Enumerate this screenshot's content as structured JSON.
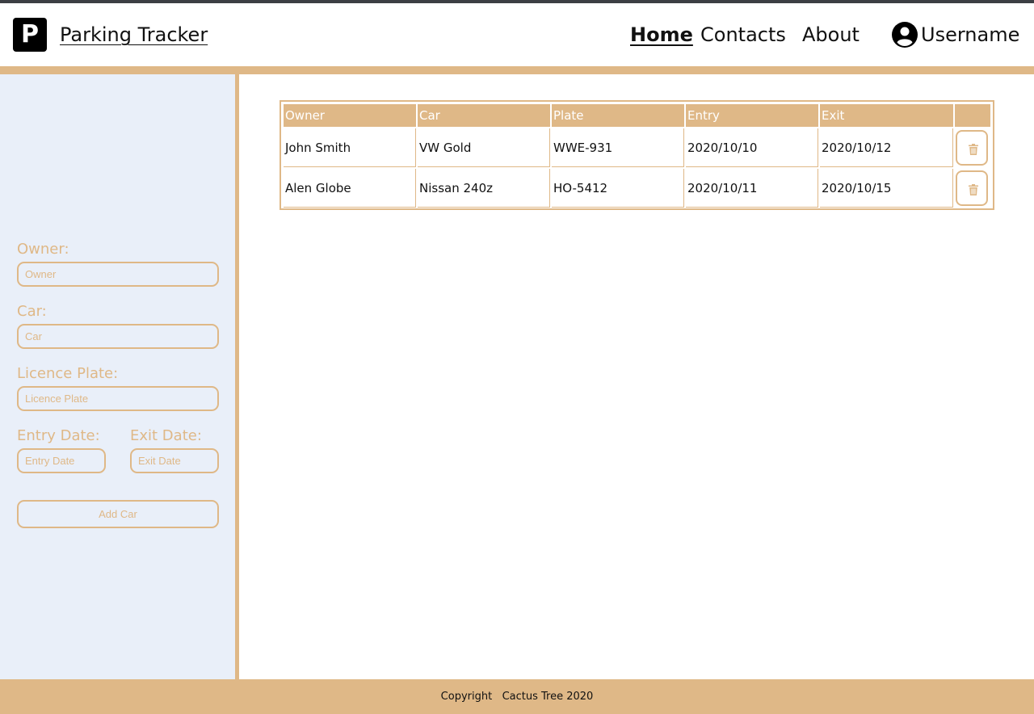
{
  "header": {
    "logo_letter": "P",
    "brand": "Parking Tracker",
    "nav": {
      "home": "Home",
      "contacts": "Contacts",
      "about": "About"
    },
    "username": "Username"
  },
  "form": {
    "owner": {
      "label": "Owner:",
      "placeholder": "Owner"
    },
    "car": {
      "label": "Car:",
      "placeholder": "Car"
    },
    "plate": {
      "label": "Licence Plate:",
      "placeholder": "Licence Plate"
    },
    "entry": {
      "label": "Entry Date:",
      "placeholder": "Entry Date"
    },
    "exit": {
      "label": "Exit Date:",
      "placeholder": "Exit Date"
    },
    "submit": "Add Car"
  },
  "table": {
    "columns": [
      "Owner",
      "Car",
      "Plate",
      "Entry",
      "Exit"
    ],
    "rows": [
      [
        "John Smith",
        "VW Gold",
        "WWE-931",
        "2020/10/10",
        "2020/10/12"
      ],
      [
        "Alen Globe",
        "Nissan 240z",
        "HO-5412",
        "2020/10/11",
        "2020/10/15"
      ]
    ],
    "row_action_icon": "trash-icon"
  },
  "footer": {
    "text": "Copyright   Cactus Tree 2020"
  },
  "colors": {
    "accent": "#dfb887",
    "sidebar_bg": "#e9eff9",
    "text": "#111111"
  }
}
